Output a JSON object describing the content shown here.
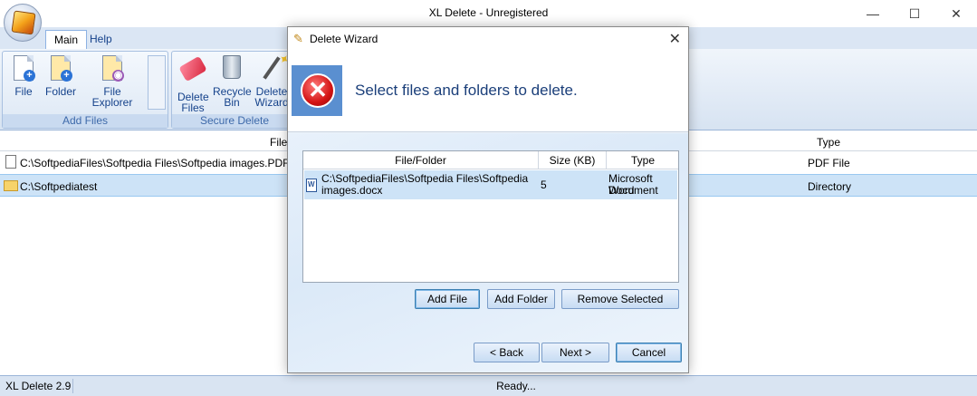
{
  "window": {
    "title": "XL Delete - Unregistered",
    "controls": {
      "minimize": "—",
      "maximize": "☐",
      "close": "✕"
    }
  },
  "ribbon": {
    "tabs": [
      {
        "label": "Main",
        "active": true
      },
      {
        "label": "Help",
        "active": false
      }
    ],
    "groups": [
      {
        "label": "Add Files",
        "buttons": [
          {
            "label": "File"
          },
          {
            "label": "Folder"
          },
          {
            "label": "File Explorer"
          }
        ]
      },
      {
        "label": "Secure Delete",
        "buttons": [
          {
            "label": "Delete Files"
          },
          {
            "label": "Recycle Bin"
          },
          {
            "label": "Delete Wizard"
          }
        ]
      }
    ]
  },
  "file_list": {
    "columns": {
      "file": "File",
      "type": "Type"
    },
    "rows": [
      {
        "path": "C:\\SoftpediaFiles\\Softpedia Files\\Softpedia images.PDF",
        "type": "PDF File",
        "selected": false
      },
      {
        "path": "C:\\Softpediatest",
        "type": "Directory",
        "selected": true
      }
    ]
  },
  "status": {
    "version": "XL Delete 2.9",
    "state": "Ready..."
  },
  "dialog": {
    "title": "Delete Wizard",
    "close": "✕",
    "heading": "Select files and folders to delete.",
    "list": {
      "columns": {
        "file_folder": "File/Folder",
        "size": "Size (KB)",
        "type": "Type"
      },
      "rows": [
        {
          "file_line1": "C:\\SoftpediaFiles\\Softpedia Files\\Softpedia",
          "file_line2": "images.docx",
          "size": "5",
          "type_line1": "Microsoft Word",
          "type_line2": "Document"
        }
      ]
    },
    "buttons": {
      "add_file": "Add File",
      "add_folder": "Add Folder",
      "remove_selected": "Remove Selected",
      "back": "< Back",
      "next": "Next >",
      "cancel": "Cancel"
    }
  },
  "colors": {
    "accent": "#15428b",
    "selection": "#cde3f7",
    "heading": "#1b3f7a"
  }
}
